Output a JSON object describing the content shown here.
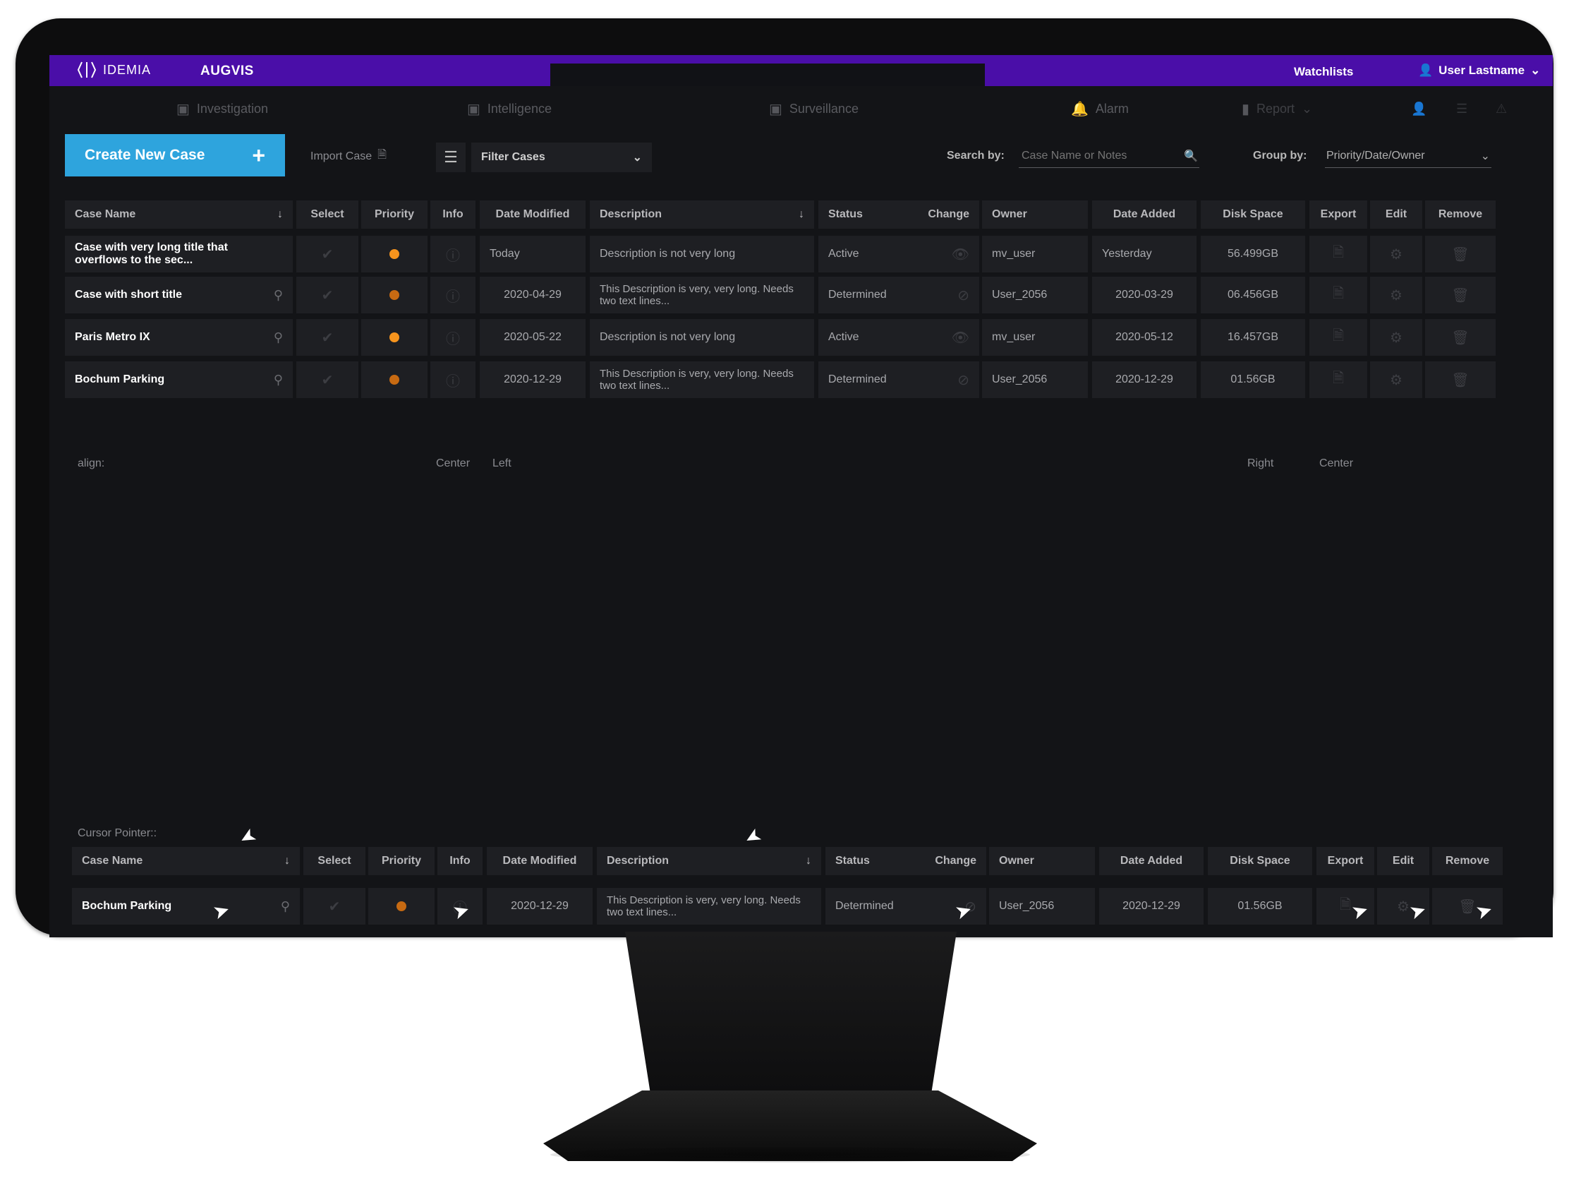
{
  "header": {
    "logo_text": "IDEMIA",
    "app_name": "AUGVIS",
    "watchlists": "Watchlists",
    "user_name": "User Lastname",
    "colors": {
      "topbar": "#4a0ea8",
      "accent": "#2ea4dd",
      "priority_high": "#f7941d",
      "priority_mid": "#c76a12"
    }
  },
  "nav": {
    "items": [
      {
        "label": "Investigation",
        "icon": "investigation-icon"
      },
      {
        "label": "Intelligence",
        "icon": "intelligence-icon"
      },
      {
        "label": "Surveillance",
        "icon": "surveillance-icon"
      },
      {
        "label": "Alarm",
        "icon": "bell-icon"
      },
      {
        "label": "Report",
        "icon": "bookmark-icon"
      }
    ]
  },
  "toolbar": {
    "create_label": "Create New Case",
    "import_label": "Import Case",
    "filter_label": "Filter Cases",
    "search_label": "Search by:",
    "search_placeholder": "Case Name or Notes",
    "group_label": "Group by:",
    "group_value": "Priority/Date/Owner"
  },
  "table": {
    "headers": {
      "case_name": "Case Name",
      "select": "Select",
      "priority": "Priority",
      "info": "Info",
      "date_modified": "Date  Modified",
      "description": "Description",
      "status": "Status",
      "change": "Change",
      "owner": "Owner",
      "date_added": "Date Added",
      "disk_space": "Disk Space",
      "export": "Export",
      "edit": "Edit",
      "remove": "Remove"
    },
    "rows": [
      {
        "name": "Case with very long title that overflows to the sec...",
        "date_modified": "Today",
        "description": "Description is not very long",
        "status": "Active",
        "owner": "mv_user",
        "date_added": "Yesterday",
        "disk_space": "56.499GB"
      },
      {
        "name": "Case with short title",
        "date_modified": "2020-04-29",
        "description": "This Description is very, very long. Needs two text lines...",
        "status": "Determined",
        "owner": "User_2056",
        "date_added": "2020-03-29",
        "disk_space": "06.456GB"
      },
      {
        "name": "Paris Metro IX",
        "date_modified": "2020-05-22",
        "description": "Description is not very long",
        "status": "Active",
        "owner": "mv_user",
        "date_added": "2020-05-12",
        "disk_space": "16.457GB"
      },
      {
        "name": "Bochum Parking",
        "date_modified": "2020-12-29",
        "description": "This Description is very, very long. Needs two text lines...",
        "status": "Determined",
        "owner": "User_2056",
        "date_added": "2020-12-29",
        "disk_space": "01.56GB"
      }
    ]
  },
  "align_notes": {
    "label": "align:",
    "center1": "Center",
    "left": "Left",
    "right": "Right",
    "center2": "Center"
  },
  "cursor_section": {
    "label": "Cursor Pointer::",
    "row": {
      "name": "Bochum Parking",
      "date_modified": "2020-12-29",
      "description": "This Description is very, very long. Needs two text lines...",
      "status": "Determined",
      "owner": "User_2056",
      "date_added": "2020-12-29",
      "disk_space": "01.56GB"
    }
  }
}
